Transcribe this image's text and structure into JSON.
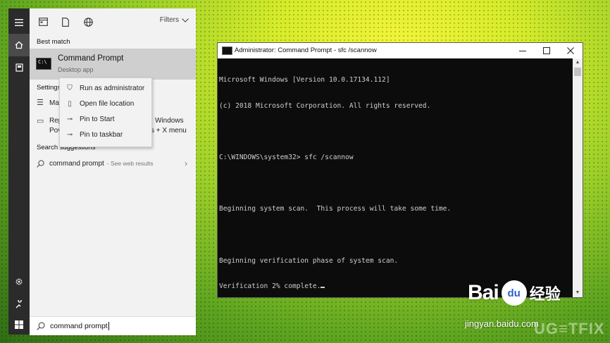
{
  "sidebar": {
    "icons": [
      "hamburger-icon",
      "home-icon",
      "documents-icon",
      "settings-icon",
      "user-icon",
      "windows-start-icon"
    ]
  },
  "start_menu": {
    "top_icons": [
      "all-tab-icon",
      "documents-tab-icon",
      "web-tab-icon"
    ],
    "filters_label": "Filters",
    "best_match_label": "Best match",
    "best_match": {
      "title": "Command Prompt",
      "subtitle": "Desktop app"
    },
    "settings_label": "Settings",
    "settings_items": [
      {
        "left": "Ma",
        "right": ""
      },
      {
        "left": "Rep",
        "right": "Windows"
      },
      {
        "left": "Pov",
        "right": "s + X menu"
      }
    ],
    "search_suggestions_label": "Search suggestions",
    "suggestion": {
      "text": "command prompt",
      "hint": "- See web results"
    },
    "search": {
      "value": "command prompt"
    }
  },
  "context_menu": {
    "items": [
      {
        "label": "Run as administrator",
        "icon": "shield-icon"
      },
      {
        "label": "Open file location",
        "icon": "file-icon"
      },
      {
        "label": "Pin to Start",
        "icon": "pin-icon"
      },
      {
        "label": "Pin to taskbar",
        "icon": "pin-icon"
      }
    ]
  },
  "console_window": {
    "title": "Administrator: Command Prompt - sfc  /scannow",
    "buttons": [
      "minimize",
      "maximize",
      "close"
    ],
    "lines": [
      "Microsoft Windows [Version 10.0.17134.112]",
      "(c) 2018 Microsoft Corporation. All rights reserved.",
      "",
      "C:\\WINDOWS\\system32> sfc /scannow",
      "",
      "Beginning system scan.  This process will take some time.",
      "",
      "Beginning verification phase of system scan.",
      "Verification 2% complete."
    ]
  },
  "watermarks": {
    "baidu_text": "Bai",
    "baidu_paw": "du",
    "baidu_cn": "经验",
    "baidu_url": "jingyan.baidu.com",
    "ugetfix": "UG≡TFIX"
  },
  "colors": {
    "console_bg": "#0c0c0c",
    "console_text": "#cfcfcf",
    "start_panel": "#f2f2f2",
    "selected_row": "#cfcfcf",
    "strip": "#2b2b2b"
  }
}
